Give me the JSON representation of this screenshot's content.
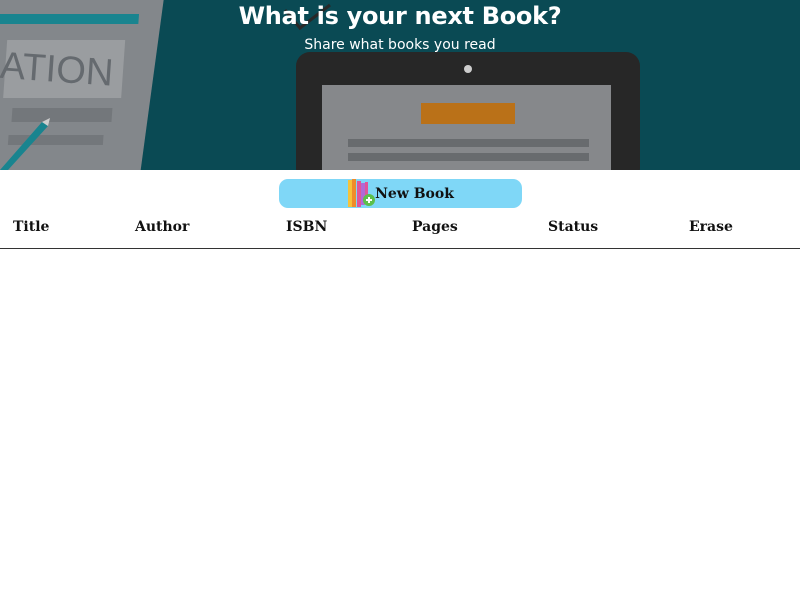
{
  "hero": {
    "title": "What is your next Book?",
    "subtitle": "Share what books you read",
    "background_text": "ATION"
  },
  "toolbar": {
    "new_book_label": "New Book",
    "new_book_icon": "books-add-icon",
    "button_color": "#7fd7f7"
  },
  "table": {
    "columns": [
      "Title",
      "Author",
      "ISBN",
      "Pages",
      "Status",
      "Erase"
    ],
    "rows": []
  },
  "colors": {
    "hero_background": "#0a4f5a",
    "accent_orange": "#d77a1a"
  }
}
